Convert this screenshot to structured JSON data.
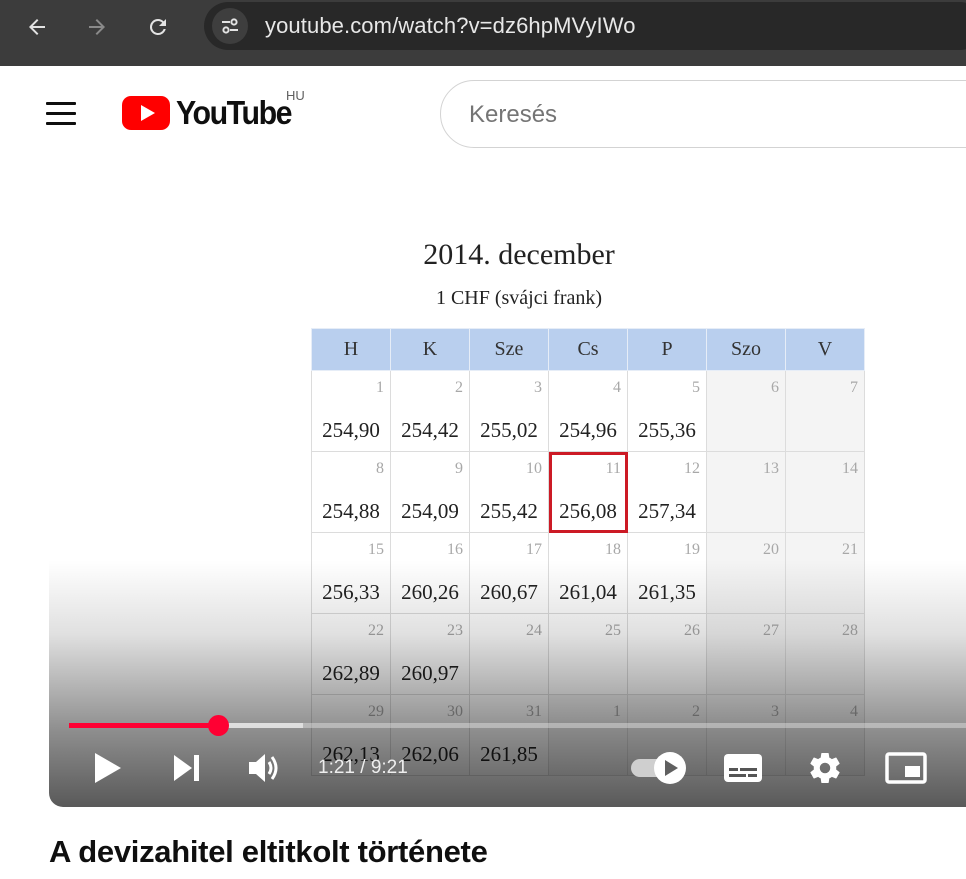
{
  "browser": {
    "url": "youtube.com/watch?v=dz6hpMVyIWo",
    "icons": [
      "back-icon",
      "forward-icon",
      "reload-icon",
      "site-info-icon"
    ]
  },
  "header": {
    "logo_text": "YouTube",
    "region": "HU",
    "search_placeholder": "Keresés",
    "brand_color": "#ff0000"
  },
  "video_frame": {
    "title": "2014. december",
    "subtitle": "1 CHF (svájci frank)",
    "weekdays": [
      "H",
      "K",
      "Sze",
      "Cs",
      "P",
      "Szo",
      "V"
    ],
    "weeks": [
      [
        {
          "day": "1",
          "value": "254,90"
        },
        {
          "day": "2",
          "value": "254,42"
        },
        {
          "day": "3",
          "value": "255,02"
        },
        {
          "day": "4",
          "value": "254,96"
        },
        {
          "day": "5",
          "value": "255,36"
        },
        {
          "day": "6",
          "value": ""
        },
        {
          "day": "7",
          "value": ""
        }
      ],
      [
        {
          "day": "8",
          "value": "254,88"
        },
        {
          "day": "9",
          "value": "254,09"
        },
        {
          "day": "10",
          "value": "255,42"
        },
        {
          "day": "11",
          "value": "256,08",
          "highlight": true
        },
        {
          "day": "12",
          "value": "257,34"
        },
        {
          "day": "13",
          "value": ""
        },
        {
          "day": "14",
          "value": ""
        }
      ],
      [
        {
          "day": "15",
          "value": "256,33"
        },
        {
          "day": "16",
          "value": "260,26"
        },
        {
          "day": "17",
          "value": "260,67"
        },
        {
          "day": "18",
          "value": "261,04"
        },
        {
          "day": "19",
          "value": "261,35"
        },
        {
          "day": "20",
          "value": ""
        },
        {
          "day": "21",
          "value": ""
        }
      ],
      [
        {
          "day": "22",
          "value": "262,89"
        },
        {
          "day": "23",
          "value": "260,97"
        },
        {
          "day": "24",
          "value": ""
        },
        {
          "day": "25",
          "value": ""
        },
        {
          "day": "26",
          "value": ""
        },
        {
          "day": "27",
          "value": ""
        },
        {
          "day": "28",
          "value": ""
        }
      ],
      [
        {
          "day": "29",
          "value": "262,13"
        },
        {
          "day": "30",
          "value": "262,06"
        },
        {
          "day": "31",
          "value": "261,85"
        },
        {
          "day": "1",
          "value": ""
        },
        {
          "day": "2",
          "value": ""
        },
        {
          "day": "3",
          "value": ""
        },
        {
          "day": "4",
          "value": ""
        }
      ]
    ]
  },
  "player": {
    "time": "1:21 / 9:21",
    "played_fraction": 0.166,
    "buffered_fraction": 0.26,
    "progress_color": "#ff0033",
    "controls": [
      "play-icon",
      "next-icon",
      "volume-icon",
      "autoplay-toggle-icon",
      "subtitles-icon",
      "settings-icon",
      "miniplayer-icon"
    ]
  },
  "video_title": "A devizahitel eltitkolt története"
}
